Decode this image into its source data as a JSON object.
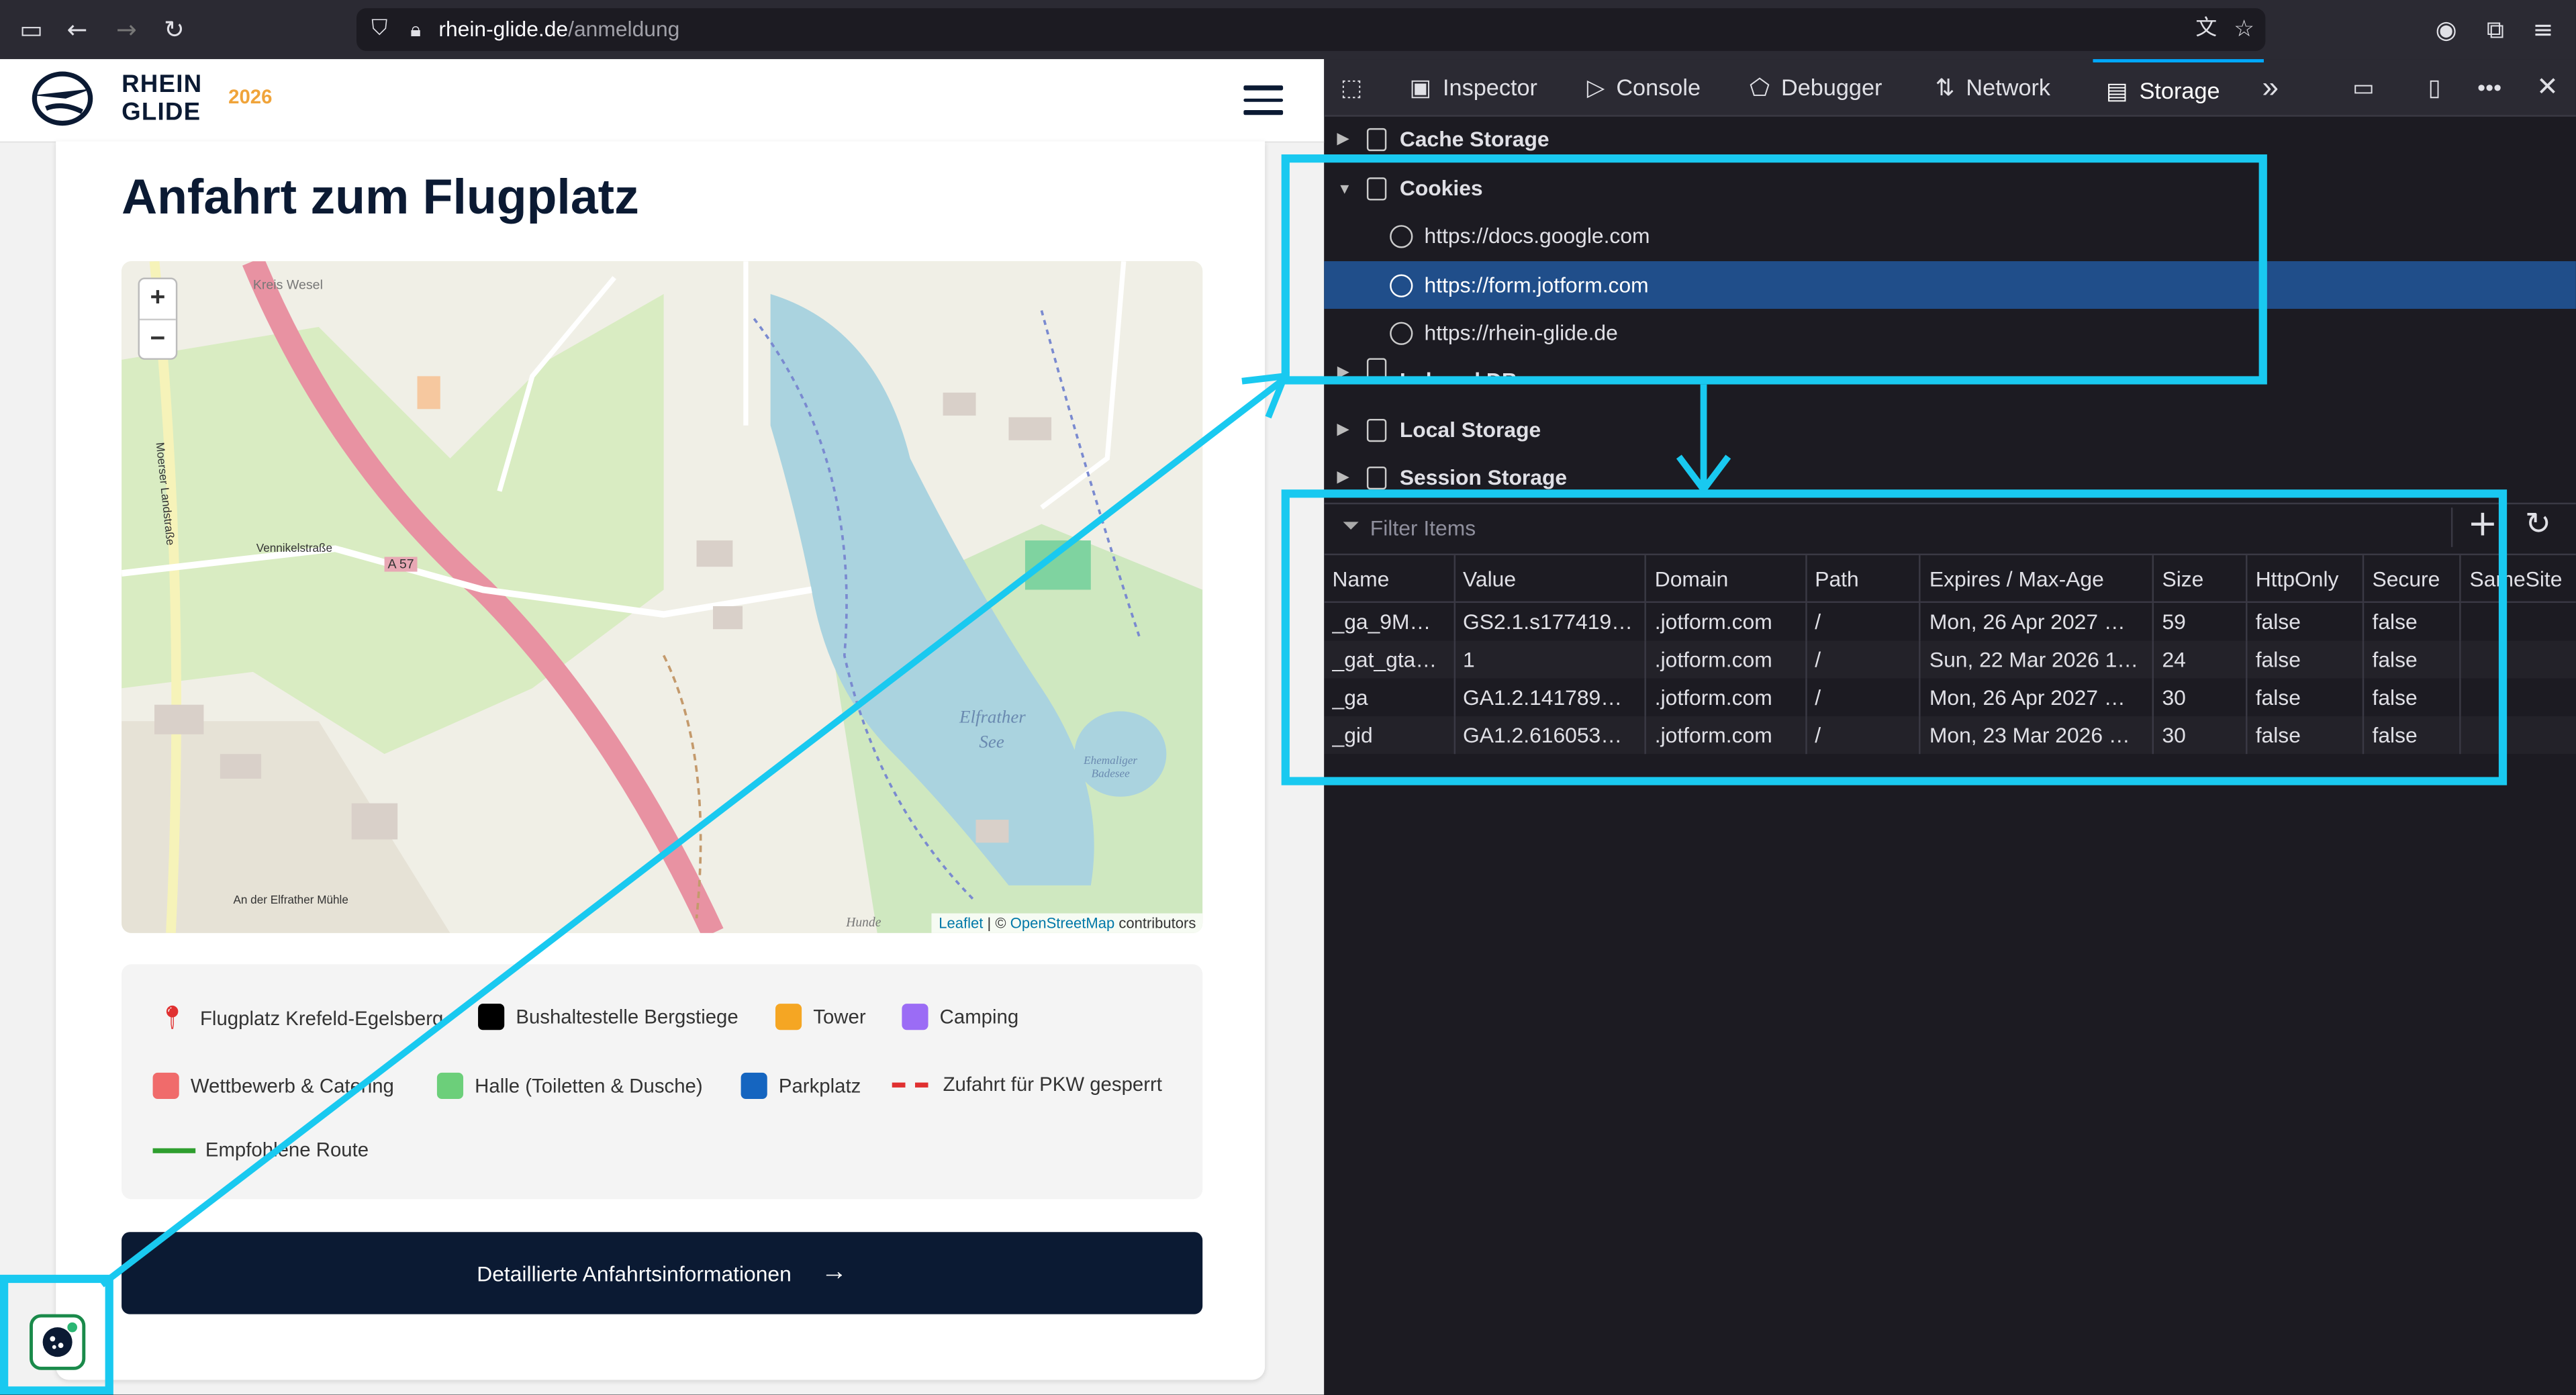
{
  "browser": {
    "url_host": "rhein-glide.de",
    "url_path": "/anmeldung"
  },
  "site": {
    "logo_line1": "RHEIN",
    "logo_line2": "GLIDE",
    "logo_year": "2026",
    "page_title": "Anfahrt zum Flugplatz",
    "map": {
      "zoom_in": "+",
      "zoom_out": "−",
      "labels": {
        "lake": "Elfrather",
        "lake2": "See",
        "road_a57": "A 57",
        "kreis": "Kreis Wesel",
        "muehle": "An der Elfrather Mühle",
        "vennikel": "Vennikelstraße",
        "moerser": "Moerser Landstraße",
        "badesee": "Ehemaliger Badesee",
        "hunde": "Hunde"
      },
      "attribution_leaflet": "Leaflet",
      "attribution_sep": " | © ",
      "attribution_osm": "OpenStreetMap",
      "attribution_suffix": " contributors"
    },
    "legend": [
      {
        "label": "Flugplatz Krefeld-Egelsberg",
        "color": "#e03030",
        "kind": "pin"
      },
      {
        "label": "Bushaltestelle Bergstiege",
        "color": "#000000",
        "kind": "box"
      },
      {
        "label": "Tower",
        "color": "#f5a623",
        "kind": "box"
      },
      {
        "label": "Camping",
        "color": "#9b6cf5",
        "kind": "box"
      },
      {
        "label": "Wettbewerb & Catering",
        "color": "#f06b6b",
        "kind": "box"
      },
      {
        "label": "Halle (Toiletten & Dusche)",
        "color": "#6ccf7a",
        "kind": "box"
      },
      {
        "label": "Parkplatz",
        "color": "#1565c0",
        "kind": "box"
      },
      {
        "label": "Zufahrt für PKW gesperrt",
        "color": "#e03030",
        "kind": "dash"
      },
      {
        "label": "Empfohlene Route",
        "color": "#2e9e2e",
        "kind": "line"
      }
    ],
    "cta_label": "Detaillierte Anfahrtsinformationen"
  },
  "devtools": {
    "tabs": [
      "Inspector",
      "Console",
      "Debugger",
      "Network",
      "Storage"
    ],
    "selected_tab": "Storage",
    "tree": {
      "cache": "Cache Storage",
      "cookies": "Cookies",
      "hosts": [
        "https://docs.google.com",
        "https://form.jotform.com",
        "https://rhein-glide.de"
      ],
      "indexed": "Indexed DB",
      "local": "Local Storage",
      "session": "Session Storage"
    },
    "filter_placeholder": "Filter Items",
    "columns": [
      "Name",
      "Value",
      "Domain",
      "Path",
      "Expires / Max-Age",
      "Size",
      "HttpOnly",
      "Secure",
      "SameSite"
    ],
    "rows": [
      [
        "_ga_9M…",
        "GS2.1.s177419…",
        ".jotform.com",
        "/",
        "Mon, 26 Apr 2027 …",
        "59",
        "false",
        "false",
        ""
      ],
      [
        "_gat_gta…",
        "1",
        ".jotform.com",
        "/",
        "Sun, 22 Mar 2026 1…",
        "24",
        "false",
        "false",
        ""
      ],
      [
        "_ga",
        "GA1.2.141789…",
        ".jotform.com",
        "/",
        "Mon, 26 Apr 2027 …",
        "30",
        "false",
        "false",
        ""
      ],
      [
        "_gid",
        "GA1.2.616053…",
        ".jotform.com",
        "/",
        "Mon, 23 Mar 2026 …",
        "30",
        "false",
        "false",
        ""
      ]
    ]
  },
  "colors": {
    "highlight": "#19c9f0",
    "navy": "#0b1a33",
    "accent_year": "#f0a43a",
    "selection": "#204e8a"
  }
}
